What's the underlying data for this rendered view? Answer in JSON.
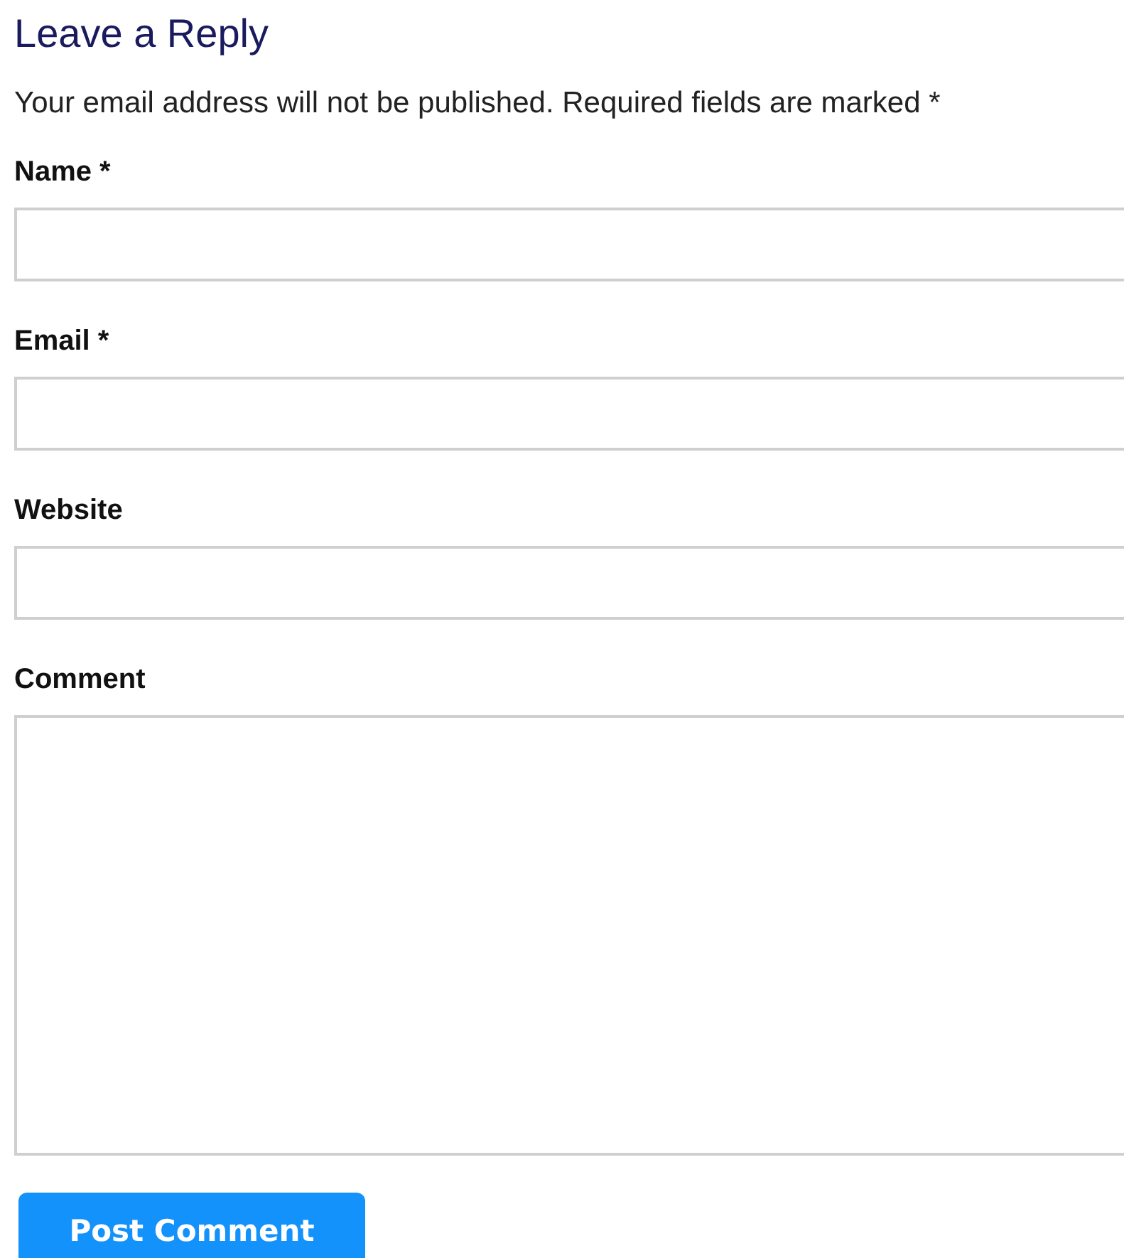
{
  "title": "Leave a Reply",
  "note": "Your email address will not be published. Required fields are marked *",
  "fields": [
    {
      "label": "Name *",
      "kind": "input"
    },
    {
      "label": "Email *",
      "kind": "input"
    },
    {
      "label": "Website",
      "kind": "input"
    },
    {
      "label": "Comment",
      "kind": "textarea"
    }
  ],
  "submit": "Post Comment"
}
